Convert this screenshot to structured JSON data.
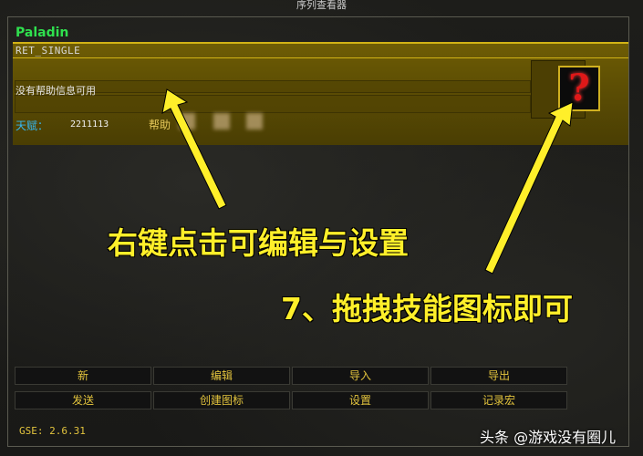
{
  "window": {
    "title": "序列查看器"
  },
  "sequence": {
    "class_name": "Paladin",
    "sequence_name": "RET_SINGLE",
    "help_text": "没有帮助信息可用",
    "talent_label": "天赋：",
    "talent_value": "2211113",
    "help_label": "帮助"
  },
  "icon": {
    "glyph": "?",
    "name": "question-mark-icon"
  },
  "annotations": {
    "edit_hint": "右键点击可编辑与设置",
    "drag_hint": "7、拖拽技能图标即可"
  },
  "buttons": {
    "row1": [
      "新",
      "编辑",
      "导入",
      "导出"
    ],
    "row2": [
      "发送",
      "创建图标",
      "设置",
      "记录宏"
    ]
  },
  "footer": {
    "version": "GSE: 2.6.31",
    "watermark": "头条 @游戏没有圈儿"
  },
  "colors": {
    "class_green": "#2fe04e",
    "gold_panel": "#6f5d05",
    "annotation_yellow": "#ffef2a",
    "button_text": "#e2c33d",
    "talent_blue": "#35b7f0"
  }
}
